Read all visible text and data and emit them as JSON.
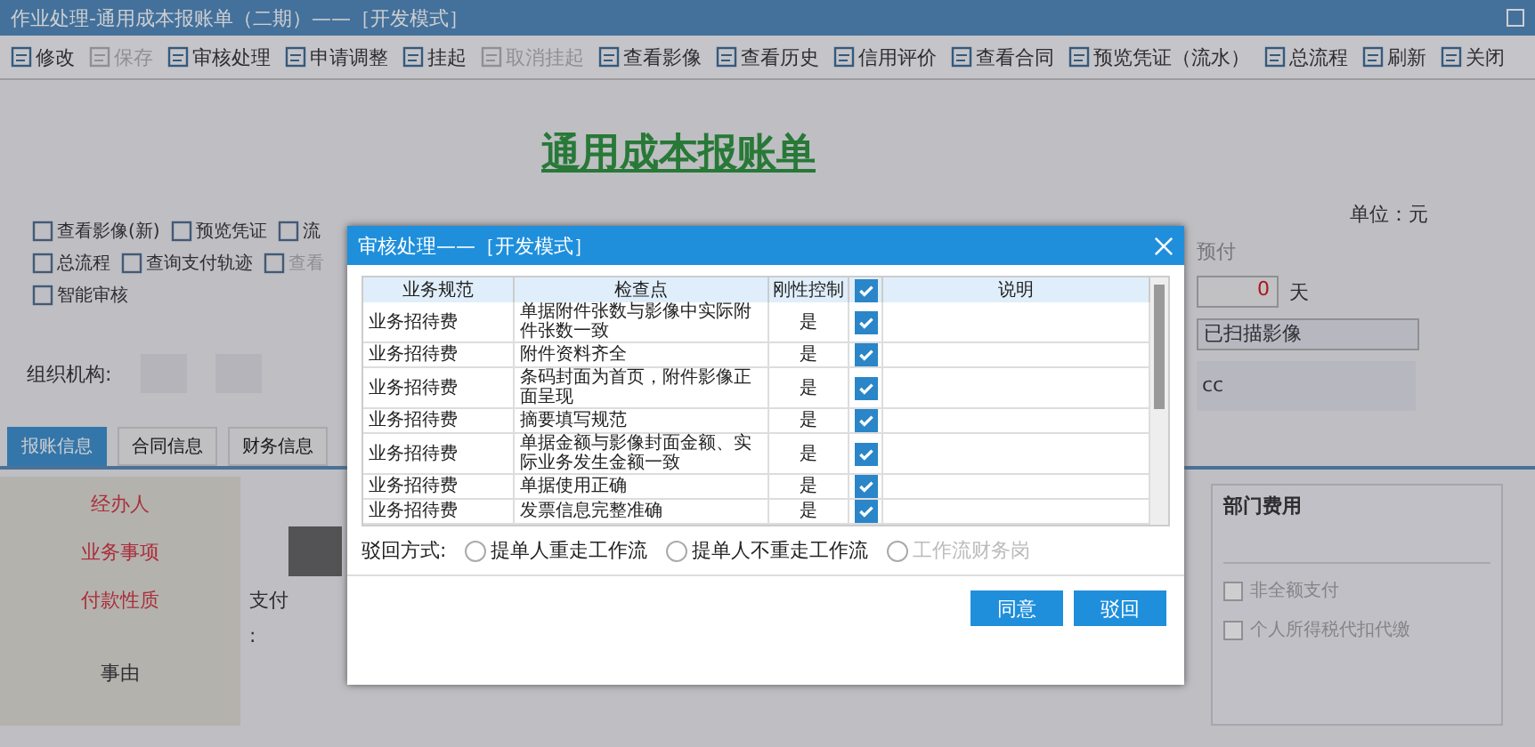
{
  "window": {
    "title": "作业处理-通用成本报账单（二期）——［开发模式］"
  },
  "toolbar": [
    {
      "label": "修改",
      "disabled": false
    },
    {
      "label": "保存",
      "disabled": true
    },
    {
      "label": "审核处理",
      "disabled": false
    },
    {
      "label": "申请调整",
      "disabled": false
    },
    {
      "label": "挂起",
      "disabled": false
    },
    {
      "label": "取消挂起",
      "disabled": true
    },
    {
      "label": "查看影像",
      "disabled": false
    },
    {
      "label": "查看历史",
      "disabled": false
    },
    {
      "label": "信用评价",
      "disabled": false
    },
    {
      "label": "查看合同",
      "disabled": false
    },
    {
      "label": "预览凭证（流水）",
      "disabled": false
    },
    {
      "label": "总流程",
      "disabled": false
    },
    {
      "label": "刷新",
      "disabled": false
    },
    {
      "label": "关闭",
      "disabled": false
    }
  ],
  "form": {
    "heading": "通用成本报账单",
    "unit": "单位：元",
    "actions": [
      [
        {
          "label": "查看影像(新)",
          "disabled": false
        },
        {
          "label": "预览凭证",
          "disabled": false
        },
        {
          "label": "流",
          "disabled": false
        }
      ],
      [
        {
          "label": "总流程",
          "disabled": false
        },
        {
          "label": "查询支付轨迹",
          "disabled": false
        },
        {
          "label": "查看",
          "disabled": true
        }
      ],
      [
        {
          "label": "智能审核",
          "disabled": false
        }
      ]
    ],
    "org_label": "组织机构:",
    "prepay_label": "预付",
    "days_value": "0",
    "days_unit": "天",
    "scan_value": "已扫描影像",
    "cc_value": "cc",
    "tabs": [
      {
        "label": "报账信息",
        "selected": true
      },
      {
        "label": "合同信息",
        "selected": false
      },
      {
        "label": "财务信息",
        "selected": false
      }
    ],
    "left_labels": [
      "经办人",
      "业务事项",
      "付款性质",
      "事由"
    ],
    "pay_text": "支付",
    "colon_text": ":",
    "dept_label": "部门费用",
    "options": [
      {
        "label": "非全额支付",
        "checked": false
      },
      {
        "label": "个人所得税代扣代缴",
        "checked": false
      }
    ]
  },
  "dialog": {
    "title": "审核处理——［开发模式］",
    "columns": [
      "业务规范",
      "检查点",
      "刚性控制",
      "说明"
    ],
    "header_checked": true,
    "rows": [
      {
        "standard": "业务招待费",
        "checkpoint": "单据附件张数与影像中实际附件张数一致",
        "rigid": "是",
        "checked": true
      },
      {
        "standard": "业务招待费",
        "checkpoint": "附件资料齐全",
        "rigid": "是",
        "checked": true
      },
      {
        "standard": "业务招待费",
        "checkpoint": "条码封面为首页，附件影像正面呈现",
        "rigid": "是",
        "checked": true
      },
      {
        "standard": "业务招待费",
        "checkpoint": "摘要填写规范",
        "rigid": "是",
        "checked": true
      },
      {
        "standard": "业务招待费",
        "checkpoint": "单据金额与影像封面金额、实际业务发生金额一致",
        "rigid": "是",
        "checked": true
      },
      {
        "standard": "业务招待费",
        "checkpoint": "单据使用正确",
        "rigid": "是",
        "checked": true
      },
      {
        "standard": "业务招待费",
        "checkpoint": "发票信息完整准确",
        "rigid": "是",
        "checked": true
      }
    ],
    "reject_label": "驳回方式:",
    "reject_options": [
      {
        "label": "提单人重走工作流",
        "selected": false,
        "disabled": false
      },
      {
        "label": "提单人不重走工作流",
        "selected": false,
        "disabled": false
      },
      {
        "label": "工作流财务岗",
        "selected": false,
        "disabled": true
      }
    ],
    "buttons": [
      "同意",
      "驳回"
    ]
  }
}
